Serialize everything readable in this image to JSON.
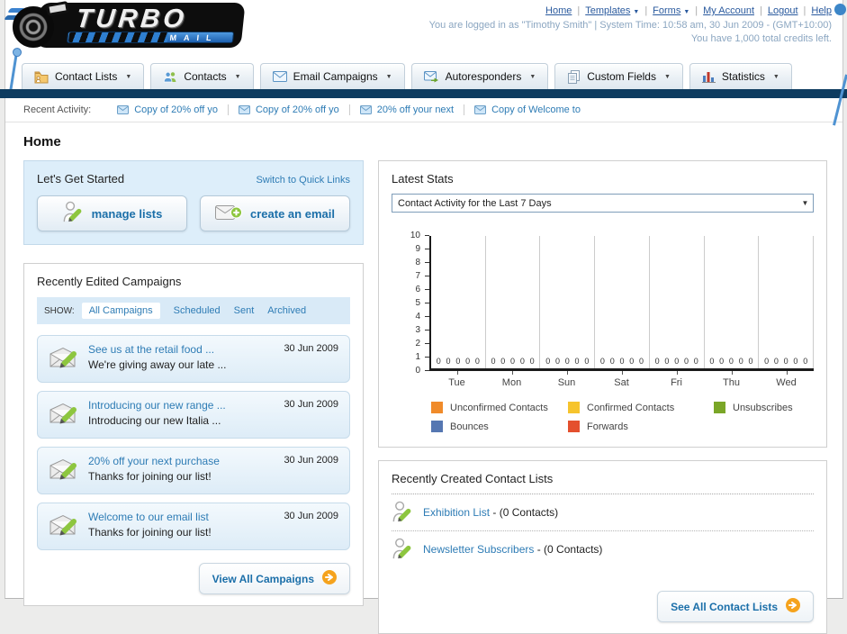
{
  "header": {
    "logo_title": "TURBO",
    "logo_subtitle": "EMAIL",
    "links": [
      {
        "label": "Home",
        "dropdown": false
      },
      {
        "label": "Templates",
        "dropdown": true
      },
      {
        "label": "Forms",
        "dropdown": true
      },
      {
        "label": "My Account",
        "dropdown": false
      },
      {
        "label": "Logout",
        "dropdown": false
      },
      {
        "label": "Help",
        "dropdown": false
      }
    ],
    "status_line": "You are logged in as \"Timothy Smith\" | System Time: 10:58 am, 30 Jun 2009 - (GMT+10:00)",
    "credits_line": "You have 1,000 total credits left."
  },
  "nav_tabs": [
    {
      "label": "Contact Lists",
      "icon": "contact-lists-icon"
    },
    {
      "label": "Contacts",
      "icon": "contacts-icon"
    },
    {
      "label": "Email Campaigns",
      "icon": "email-campaigns-icon"
    },
    {
      "label": "Autoresponders",
      "icon": "autoresponders-icon"
    },
    {
      "label": "Custom Fields",
      "icon": "custom-fields-icon"
    },
    {
      "label": "Statistics",
      "icon": "statistics-icon"
    }
  ],
  "recent_activity": {
    "label": "Recent Activity:",
    "items": [
      "Copy of 20% off yo",
      "Copy of 20% off yo",
      "20% off your next",
      "Copy of Welcome to"
    ]
  },
  "page": {
    "title": "Home"
  },
  "getting_started": {
    "title": "Let's Get Started",
    "switch_link": "Switch to Quick Links",
    "manage_lists_label": "manage lists",
    "create_email_label": "create an email"
  },
  "campaigns": {
    "title": "Recently Edited Campaigns",
    "show_label": "SHOW:",
    "filters": [
      "All Campaigns",
      "Scheduled",
      "Sent",
      "Archived"
    ],
    "active_filter": "All Campaigns",
    "items": [
      {
        "title": "See us at the retail food ...",
        "subtitle": "We're giving away our late ...",
        "date": "30 Jun 2009"
      },
      {
        "title": "Introducing our new range ...",
        "subtitle": "Introducing our new Italia ...",
        "date": "30 Jun 2009"
      },
      {
        "title": "20% off your next purchase",
        "subtitle": "Thanks for joining our list!",
        "date": "30 Jun 2009"
      },
      {
        "title": "Welcome to our email list",
        "subtitle": "Thanks for joining our list!",
        "date": "30 Jun 2009"
      }
    ],
    "view_all_label": "View All Campaigns"
  },
  "stats": {
    "title": "Latest Stats",
    "dropdown_value": "Contact Activity for the Last 7 Days"
  },
  "chart_data": {
    "type": "bar",
    "title": "Contact Activity for the Last 7 Days",
    "categories": [
      "Tue",
      "Mon",
      "Sun",
      "Sat",
      "Fri",
      "Thu",
      "Wed"
    ],
    "series": [
      {
        "name": "Unconfirmed Contacts",
        "color": "#f08b2a",
        "values": [
          0,
          0,
          0,
          0,
          0,
          0,
          0
        ]
      },
      {
        "name": "Confirmed Contacts",
        "color": "#f6c42d",
        "values": [
          0,
          0,
          0,
          0,
          0,
          0,
          0
        ]
      },
      {
        "name": "Unsubscribes",
        "color": "#7aa627",
        "values": [
          0,
          0,
          0,
          0,
          0,
          0,
          0
        ]
      },
      {
        "name": "Bounces",
        "color": "#5577b2",
        "values": [
          0,
          0,
          0,
          0,
          0,
          0,
          0
        ]
      },
      {
        "name": "Forwards",
        "color": "#e4502e",
        "values": [
          0,
          0,
          0,
          0,
          0,
          0,
          0
        ]
      }
    ],
    "ylim": [
      0,
      10
    ],
    "yticks": [
      0,
      1,
      2,
      3,
      4,
      5,
      6,
      7,
      8,
      9,
      10
    ],
    "grid": "vertical",
    "legend_position": "bottom",
    "value_labels_shown": true
  },
  "contact_lists": {
    "title": "Recently Created Contact Lists",
    "items": [
      {
        "name": "Exhibition List",
        "detail": "- (0 Contacts)"
      },
      {
        "name": "Newsletter Subscribers",
        "detail": "- (0 Contacts)"
      }
    ],
    "see_all_label": "See All Contact Lists"
  },
  "colors": {
    "navy_bar": "#0e3c60",
    "link_blue": "#2e7cb5",
    "panel_blue_bg": "#ddeefa",
    "accent_orange": "#f5a31d"
  }
}
